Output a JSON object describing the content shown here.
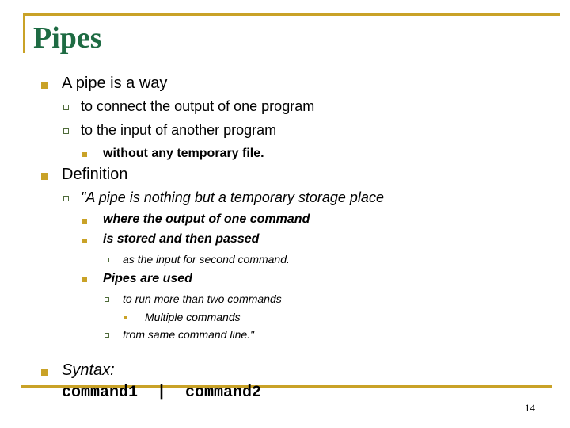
{
  "slide": {
    "title": "Pipes",
    "page_number": "14",
    "accent_color": "#c9a227",
    "title_color": "#1e6b43"
  },
  "bullets": [
    {
      "level": 1,
      "bullet": "square-bullet",
      "style": "normal",
      "text": "A pipe is a way"
    },
    {
      "level": 2,
      "bullet": "hollow-box-bullet",
      "style": "normal",
      "text": "to connect the output of one program"
    },
    {
      "level": 2,
      "bullet": "hollow-box-bullet",
      "style": "normal",
      "text": "to the input of another program"
    },
    {
      "level": 3,
      "bullet": "square-bullet",
      "style": "bold",
      "text": "without any temporary file."
    },
    {
      "level": 1,
      "bullet": "square-bullet",
      "style": "normal",
      "text": "Definition"
    },
    {
      "level": 2,
      "bullet": "hollow-box-bullet",
      "style": "italic",
      "text": "\"A pipe is nothing but a temporary storage place"
    },
    {
      "level": 3,
      "bullet": "square-bullet",
      "style": "bold-italic",
      "text": "where the output of one command"
    },
    {
      "level": 3,
      "bullet": "square-bullet",
      "style": "bold-italic",
      "text": "is stored and then passed"
    },
    {
      "level": 4,
      "bullet": "hollow-box-bullet",
      "style": "italic",
      "text": "as the input for second command."
    },
    {
      "level": 3,
      "bullet": "square-bullet",
      "style": "bold-italic",
      "text": "Pipes are used"
    },
    {
      "level": 4,
      "bullet": "hollow-box-bullet",
      "style": "italic",
      "text": "to run more than two commands"
    },
    {
      "level": 5,
      "bullet": "small-square-bullet",
      "style": "italic",
      "text": "Multiple commands"
    },
    {
      "level": 4,
      "bullet": "hollow-box-bullet",
      "style": "italic",
      "text": "from same command line.\""
    },
    {
      "level": 1,
      "bullet": "square-bullet",
      "style": "italic",
      "text": "Syntax:"
    }
  ],
  "syntax_code": "command1  |  command2"
}
